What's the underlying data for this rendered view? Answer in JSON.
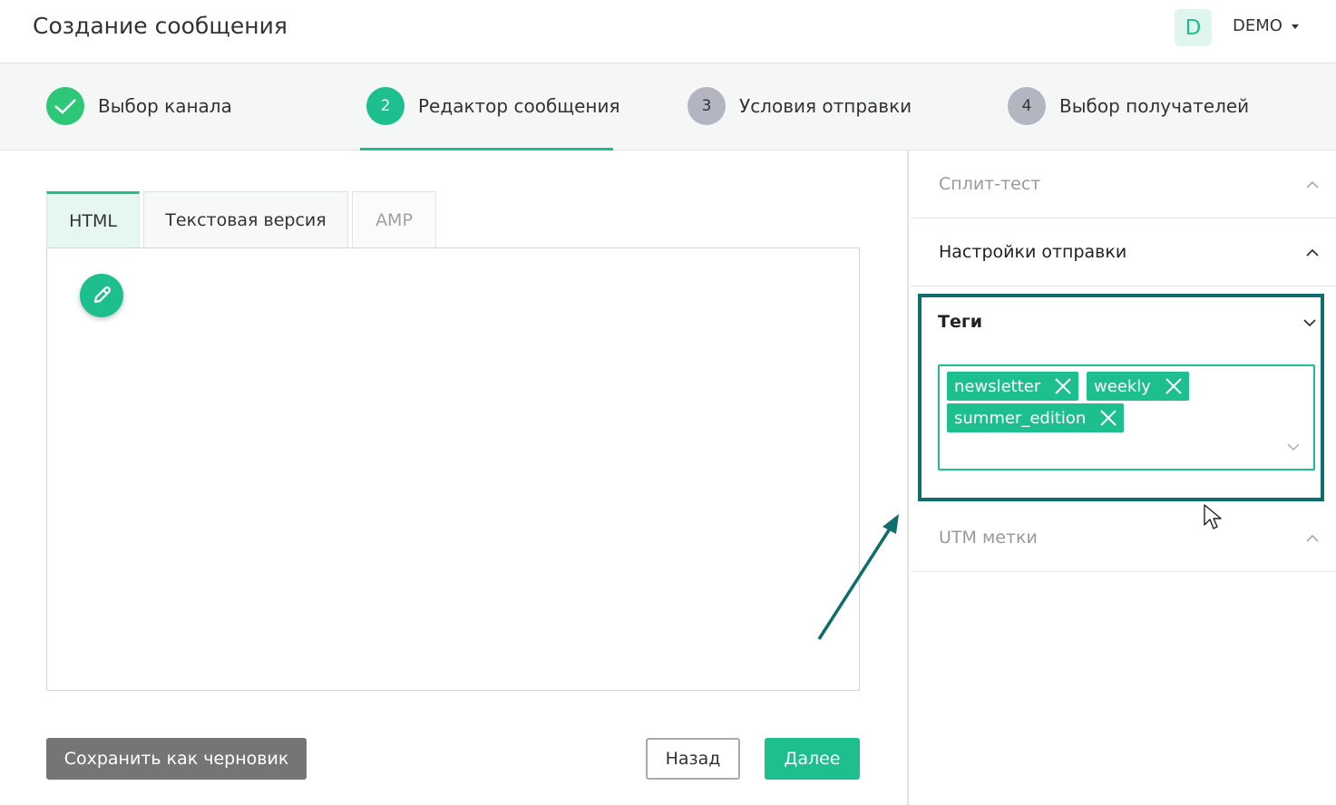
{
  "header": {
    "title": "Создание сообщения",
    "avatar_letter": "D",
    "account_name": "DEMO"
  },
  "stepper": {
    "steps": [
      {
        "number": "1",
        "label": "Выбор канала",
        "state": "done"
      },
      {
        "number": "2",
        "label": "Редактор сообщения",
        "state": "active"
      },
      {
        "number": "3",
        "label": "Условия отправки",
        "state": "pending"
      },
      {
        "number": "4",
        "label": "Выбор получателей",
        "state": "pending"
      }
    ]
  },
  "editor": {
    "tabs": [
      {
        "label": "HTML",
        "state": "active"
      },
      {
        "label": "Текстовая версия",
        "state": "normal"
      },
      {
        "label": "AMP",
        "state": "disabled"
      }
    ],
    "edit_icon": "pencil-icon"
  },
  "footer": {
    "draft_label": "Сохранить как черновик",
    "back_label": "Назад",
    "next_label": "Далее"
  },
  "sidebar": {
    "split_test": "Сплит-тест",
    "send_settings": "Настройки отправки",
    "tags": {
      "title": "Теги",
      "chips": [
        "newsletter",
        "weekly",
        "summer_edition"
      ]
    },
    "utm": "UTM метки"
  },
  "colors": {
    "accent": "#1dbf8e",
    "done": "#2ec777",
    "pending": "#b3b6c1",
    "highlight": "#0e6e6b",
    "draft_button": "#757575"
  }
}
